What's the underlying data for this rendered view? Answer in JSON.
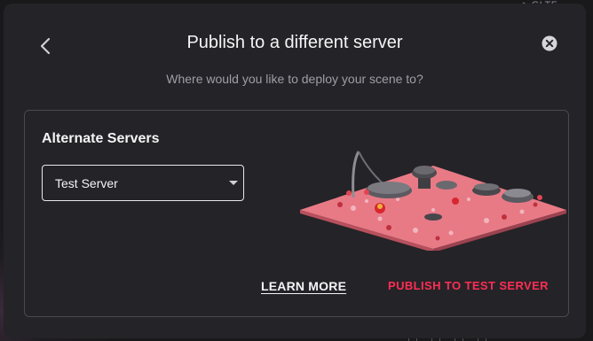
{
  "background": {
    "tab_label": "> GLTF"
  },
  "dialog": {
    "title": "Publish to a different server",
    "subtitle": "Where would you like to deploy your scene to?",
    "back_icon": "chevron-left-icon",
    "close_icon": "close-circle-icon"
  },
  "panel": {
    "heading": "Alternate Servers",
    "server_select": {
      "selected": "Test Server"
    },
    "learn_more_label": "LEARN MORE",
    "publish_label": "PUBLISH TO TEST SERVER"
  },
  "colors": {
    "dialog_bg": "#242327",
    "accent": "#ff2d55",
    "text": "#f4f4f6",
    "muted": "#a09ea6",
    "border": "#4a4950"
  }
}
